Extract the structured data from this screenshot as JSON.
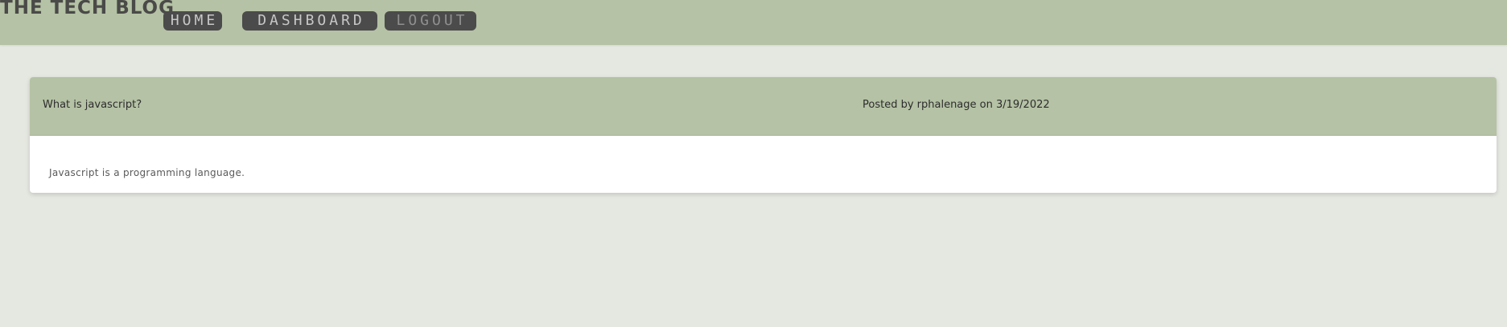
{
  "header": {
    "site_title": "THE TECH BLOG",
    "nav": {
      "home_label": "HOME",
      "dashboard_label": "DASHBOARD",
      "logout_label": "LOGOUT"
    }
  },
  "post": {
    "title": "What is javascript?",
    "meta": "Posted by rphalenage on 3/19/2022",
    "body": "Javascript is a programming language."
  },
  "colors": {
    "header_bg": "#b5c2a5",
    "page_bg": "#e5e7e1",
    "nav_button_bg": "#4b4b4b",
    "card_bg": "#ffffff"
  }
}
